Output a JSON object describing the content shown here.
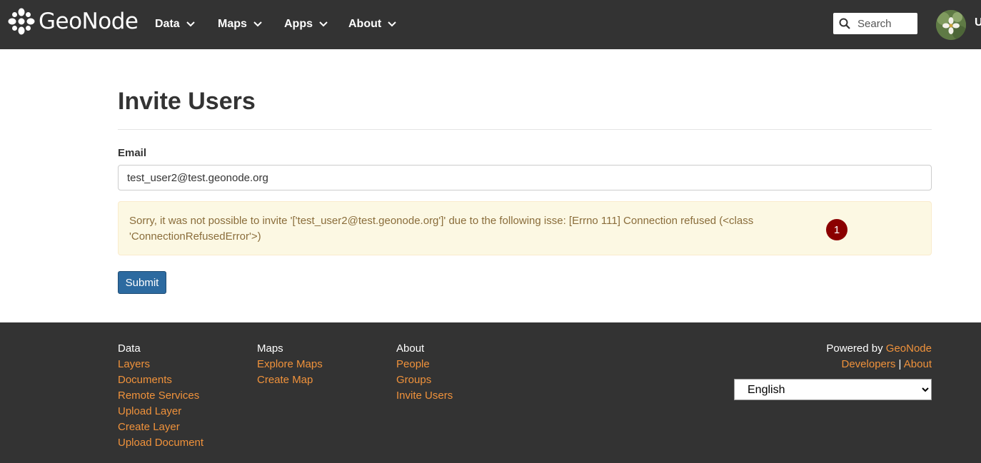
{
  "header": {
    "logo_text": "GeoNode",
    "nav": [
      {
        "label": "Data"
      },
      {
        "label": "Maps"
      },
      {
        "label": "Apps"
      },
      {
        "label": "About"
      }
    ],
    "search_placeholder": "Search",
    "user_initial": "U"
  },
  "main": {
    "title": "Invite Users",
    "email_label": "Email",
    "email_value": "test_user2@test.geonode.org",
    "alert_text": "Sorry, it was not possible to invite '['test_user2@test.geonode.org']' due to the following isse: [Errno 111] Connection refused (<class 'ConnectionRefusedError'>)",
    "badge": "1",
    "submit_label": "Submit"
  },
  "footer": {
    "columns": [
      {
        "heading": "Data",
        "links": [
          "Layers",
          "Documents",
          "Remote Services",
          "Upload Layer",
          "Create Layer",
          "Upload Document"
        ]
      },
      {
        "heading": "Maps",
        "links": [
          "Explore Maps",
          "Create Map"
        ]
      },
      {
        "heading": "About",
        "links": [
          "People",
          "Groups",
          "Invite Users"
        ]
      }
    ],
    "powered_by": "Powered by",
    "powered_link": "GeoNode",
    "developers": "Developers",
    "separator": "|",
    "about": "About",
    "language": "English"
  },
  "colors": {
    "navbar_bg": "#333333",
    "link_orange": "#f0923b",
    "alert_bg": "#fcf8e3",
    "alert_text": "#8a6d3b",
    "submit_bg": "#2c6aa0",
    "badge_bg": "#8b0000"
  }
}
